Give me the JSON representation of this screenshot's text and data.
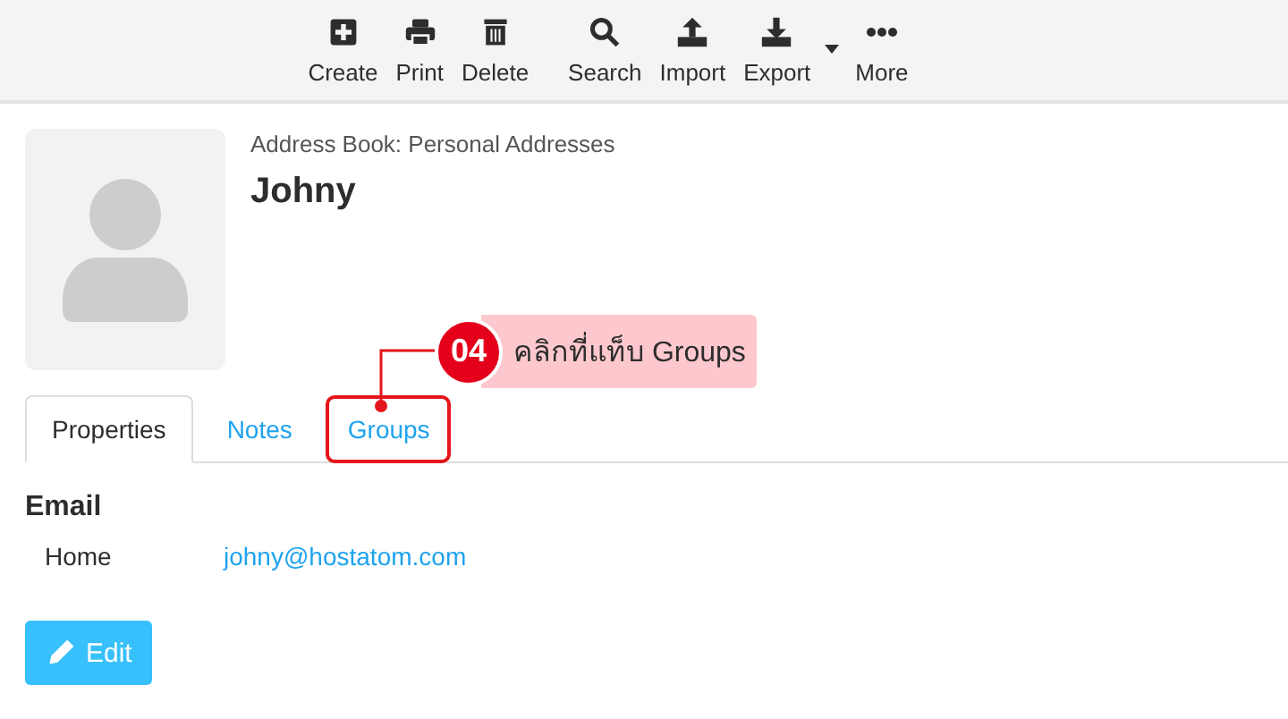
{
  "toolbar": [
    {
      "label": "Create"
    },
    {
      "label": "Print"
    },
    {
      "label": "Delete"
    },
    {
      "label": "Search"
    },
    {
      "label": "Import"
    },
    {
      "label": "Export",
      "has_menu": true
    },
    {
      "label": "More"
    }
  ],
  "contact": {
    "address_book": "Address Book: Personal Addresses",
    "name": "Johny"
  },
  "tabs": [
    {
      "label": "Properties",
      "selected": true
    },
    {
      "label": "Notes",
      "selected": false
    },
    {
      "label": "Groups",
      "selected": false,
      "highlighted": true
    }
  ],
  "callout": {
    "step": "04",
    "text": "คลิกที่แท็บ Groups"
  },
  "section": {
    "title": "Email",
    "rows": [
      {
        "label": "Home",
        "value": "johny@hostatom.com"
      }
    ]
  },
  "edit_button": "Edit"
}
